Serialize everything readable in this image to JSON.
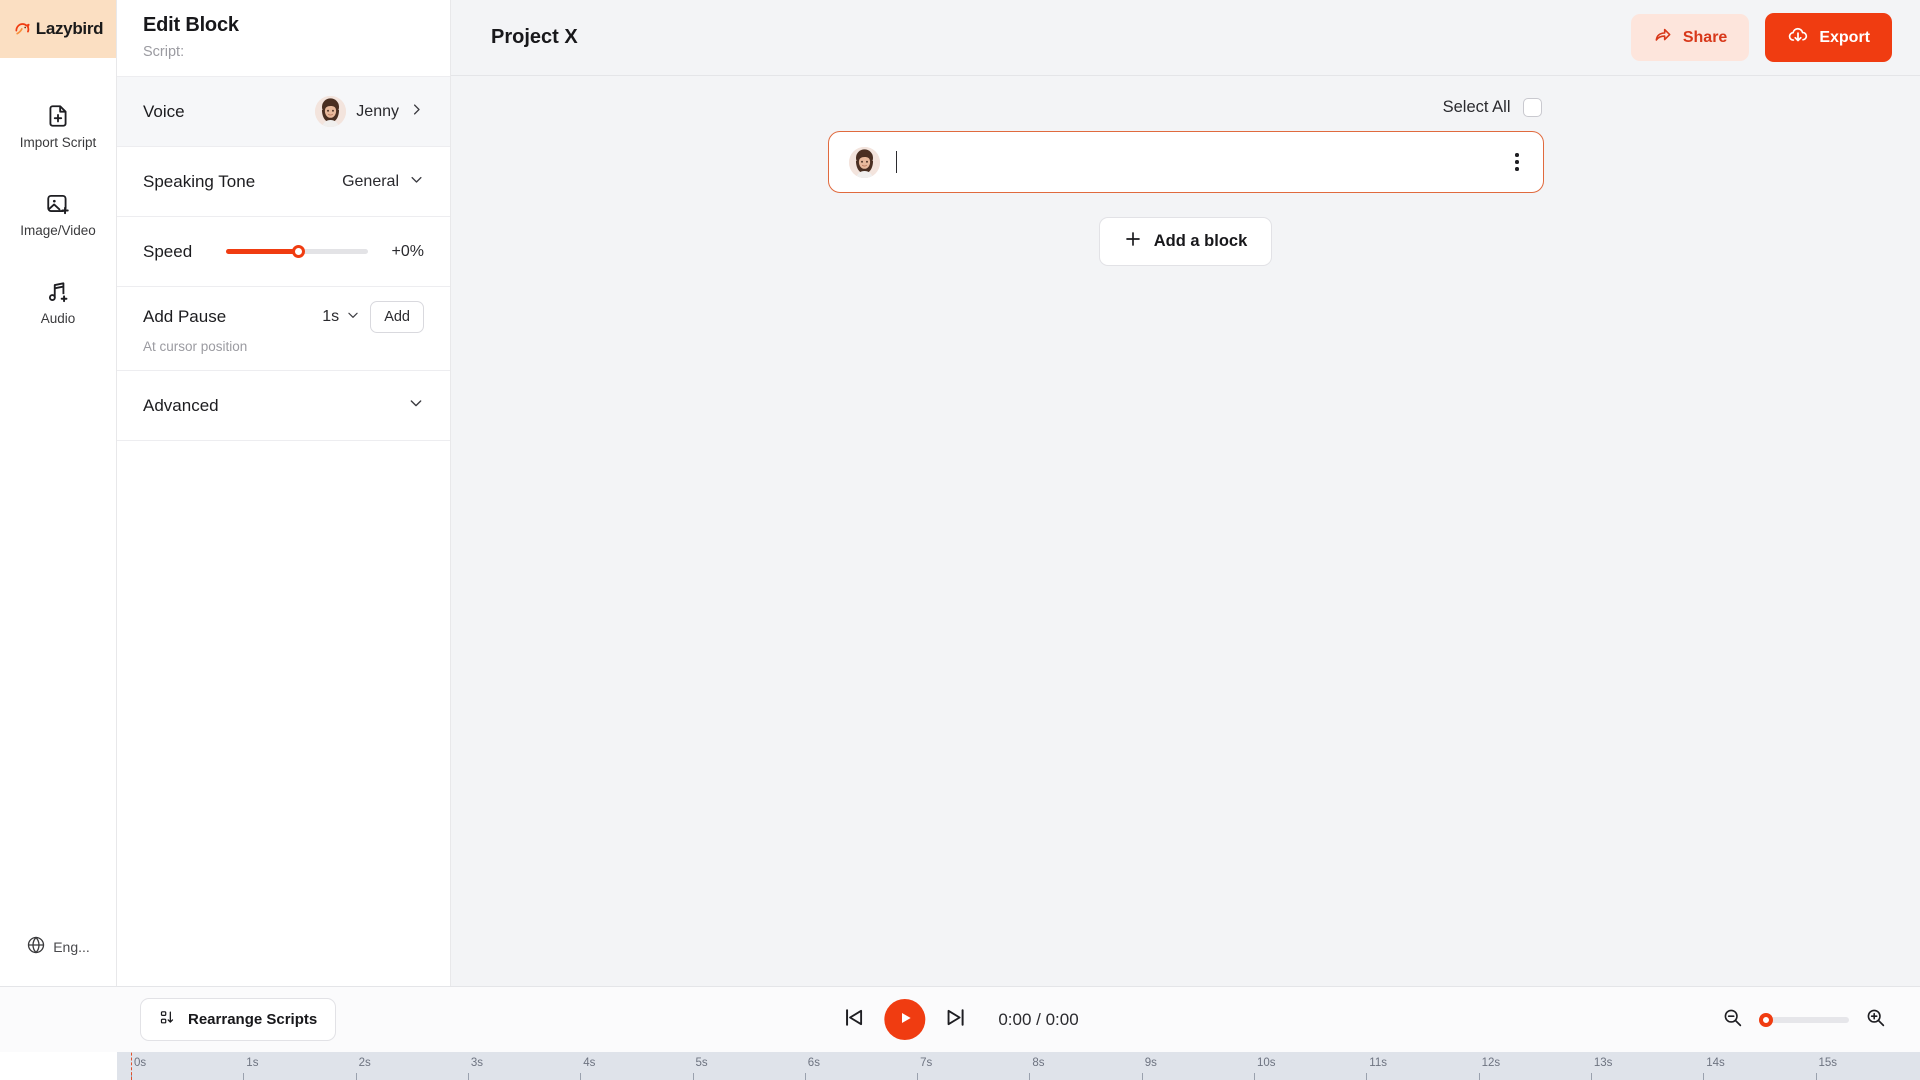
{
  "brand": {
    "name": "Lazybird"
  },
  "rail": {
    "items": [
      {
        "label": "Import Script",
        "icon": "file-plus-icon",
        "name": "import-script"
      },
      {
        "label": "Image/Video",
        "icon": "image-plus-icon",
        "name": "image-video"
      },
      {
        "label": "Audio",
        "icon": "music-plus-icon",
        "name": "audio"
      }
    ],
    "language": {
      "label": "Eng...",
      "icon": "globe-icon"
    }
  },
  "panel": {
    "title": "Edit Block",
    "subtitle": "Script:",
    "voice": {
      "label": "Voice",
      "value": "Jenny",
      "chevron": "chevron-right-icon"
    },
    "speaking_tone": {
      "label": "Speaking Tone",
      "value": "General",
      "chevron": "chevron-down-icon"
    },
    "speed": {
      "label": "Speed",
      "value": "+0%",
      "fill_percent": 51
    },
    "add_pause": {
      "label": "Add Pause",
      "note": "At cursor position",
      "duration": "1s",
      "button": "Add"
    },
    "advanced": {
      "label": "Advanced",
      "chevron": "chevron-down-icon"
    }
  },
  "topbar": {
    "project_title": "Project X",
    "share_label": "Share",
    "export_label": "Export"
  },
  "canvas": {
    "select_all_label": "Select All",
    "select_all_checked": false,
    "block": {
      "text": "",
      "menu": "kebab-menu-icon"
    },
    "add_block_label": "Add a block"
  },
  "player": {
    "rearrange_label": "Rearrange Scripts",
    "time": "0:00 / 0:00",
    "prev_icon": "skip-back-icon",
    "play_icon": "play-icon",
    "next_icon": "skip-forward-icon",
    "zoom_out_icon": "zoom-out-icon",
    "zoom_in_icon": "zoom-in-icon",
    "zoom_value": 0
  },
  "timeline": {
    "ticks": [
      "0s",
      "1s",
      "2s",
      "3s",
      "4s",
      "5s",
      "6s",
      "7s",
      "8s",
      "9s",
      "10s",
      "11s",
      "12s",
      "13s",
      "14s",
      "15s"
    ],
    "playhead_position": "0s"
  },
  "colors": {
    "accent": "#f03c11",
    "share_bg": "#fde5dc",
    "share_fg": "#d8381a",
    "logo_bg": "#fbdfc2",
    "block_border": "#e06a3e",
    "ruler_bg": "#dfe3ea"
  }
}
